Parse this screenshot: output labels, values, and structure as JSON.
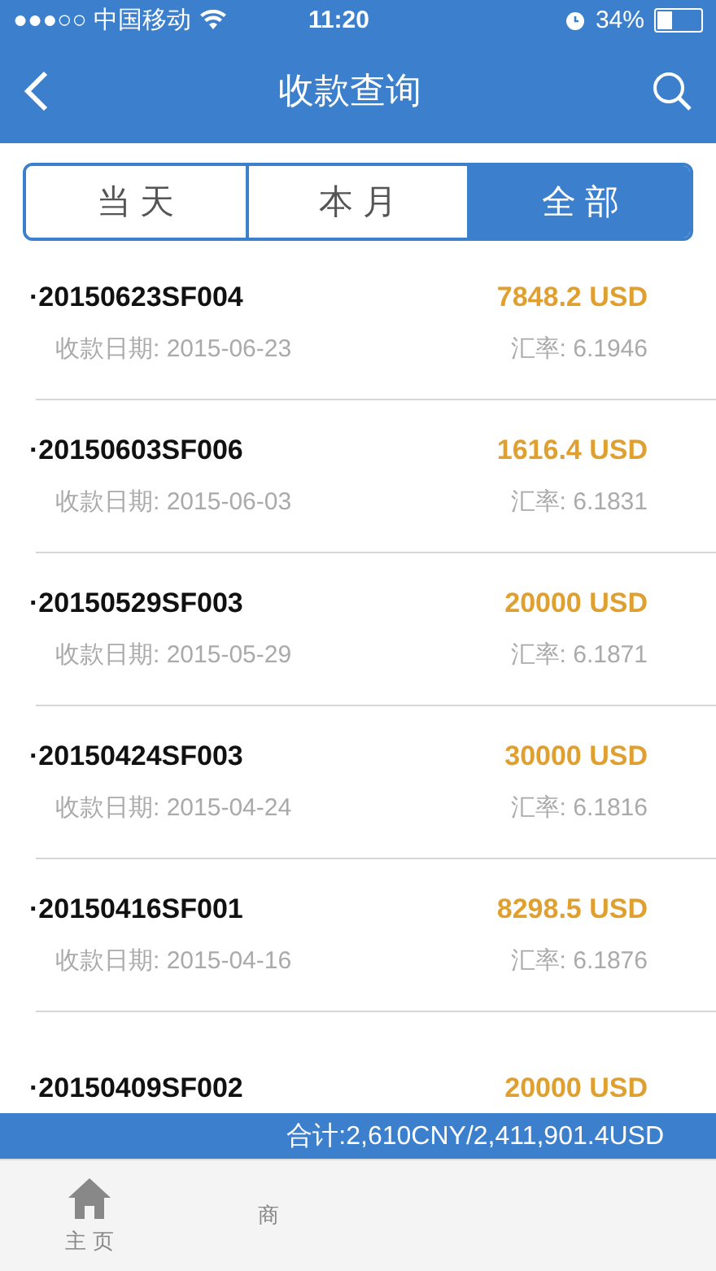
{
  "status_bar": {
    "carrier": "●●●○○ 中国移动",
    "time": "11:20",
    "battery": "34%"
  },
  "nav": {
    "title": "收款查询"
  },
  "tabs": [
    {
      "label": "当 天",
      "selected": false
    },
    {
      "label": "本 月",
      "selected": false
    },
    {
      "label": "全 部",
      "selected": true
    }
  ],
  "rows": [
    {
      "id": "·20150623SF004",
      "amount": "7848.2 USD",
      "date": "收款日期: 2015-06-23",
      "rate": "汇率: 6.1946"
    },
    {
      "id": "·20150603SF006",
      "amount": "1616.4 USD",
      "date": "收款日期: 2015-06-03",
      "rate": "汇率: 6.1831"
    },
    {
      "id": "·20150529SF003",
      "amount": "20000 USD",
      "date": "收款日期: 2015-05-29",
      "rate": "汇率: 6.1871"
    },
    {
      "id": "·20150424SF003",
      "amount": "30000 USD",
      "date": "收款日期: 2015-04-24",
      "rate": "汇率: 6.1816"
    },
    {
      "id": "·20150416SF001",
      "amount": "8298.5 USD",
      "date": "收款日期: 2015-04-16",
      "rate": "汇率: 6.1876"
    },
    {
      "id": "·20150409SF002",
      "amount": "20000 USD"
    }
  ],
  "total": "合计:2,610CNY/2,411,901.4USD",
  "tab_bar": [
    {
      "label": "主 页",
      "kind": "home"
    },
    {
      "label": "商"
    }
  ]
}
